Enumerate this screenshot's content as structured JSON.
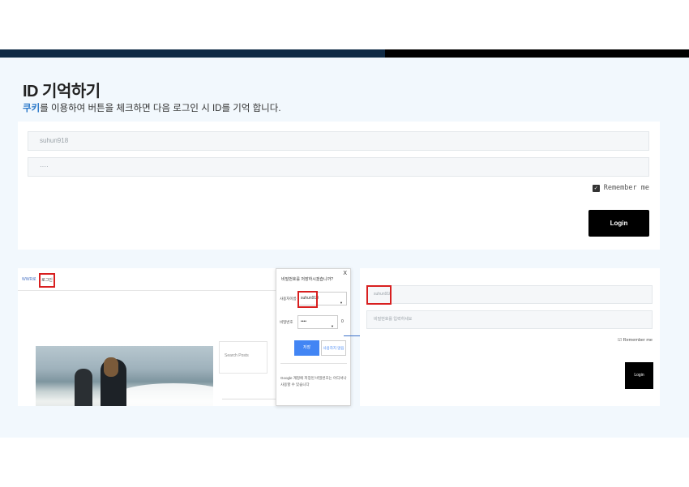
{
  "slide": {
    "title": "ID 기억하기",
    "subtitle_highlight": "쿠키",
    "subtitle_rest": "를 이용하여 버튼을 체크하면 다음 로그인 시 ID를 기억 합니다."
  },
  "login_form": {
    "username_value": "suhun918",
    "password_value": "····",
    "remember_label": "Remember me",
    "remember_checked": true,
    "login_label": "Login"
  },
  "left_screenshot": {
    "nav_text": "WWR로",
    "highlighted_link": "로그인",
    "sidebox_text": "Search Posts"
  },
  "save_password_popup": {
    "title": "비밀번호를 저장하시겠습니까?",
    "close_label": "X",
    "username_label": "사용자이름",
    "username_value": "suhun918",
    "password_label": "비밀번호",
    "password_value": "••••",
    "password_extra": "0",
    "save_label": "저장",
    "never_label": "사용하지 않음",
    "note": "Google 계정에 저장된 비밀번호는 어디서나 사용할 수 있습니다"
  },
  "right_screenshot": {
    "username_value": "suhun918",
    "password_placeholder": "비밀번호를 입력하세요",
    "remember_label": "☑ Remember me",
    "login_label": "Login"
  },
  "colors": {
    "accent_blue": "#2a78c9",
    "top_bar_dark": "#0f2a45",
    "highlight_red": "#d81f1f"
  }
}
